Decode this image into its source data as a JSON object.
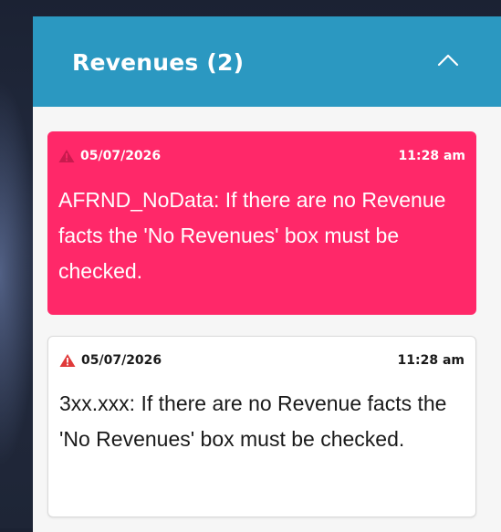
{
  "panel": {
    "title": "Revenues (2)",
    "collapse_icon": "chevron-up-icon",
    "colors": {
      "header": "#2b98c1",
      "error_card": "#ff2869",
      "warning_icon_normal": "#e03a3a",
      "warning_icon_error": "#c91a4e"
    }
  },
  "items": [
    {
      "severity": "error",
      "icon": "warning-triangle-icon",
      "date": "05/07/2026",
      "time": "11:28 am",
      "message": "AFRND_NoData: If there are no Revenue facts the 'No Revenues' box must be checked."
    },
    {
      "severity": "normal",
      "icon": "warning-triangle-icon",
      "date": "05/07/2026",
      "time": "11:28 am",
      "message": "3xx.xxx: If there are no Revenue facts the 'No Revenues' box must be checked."
    }
  ]
}
